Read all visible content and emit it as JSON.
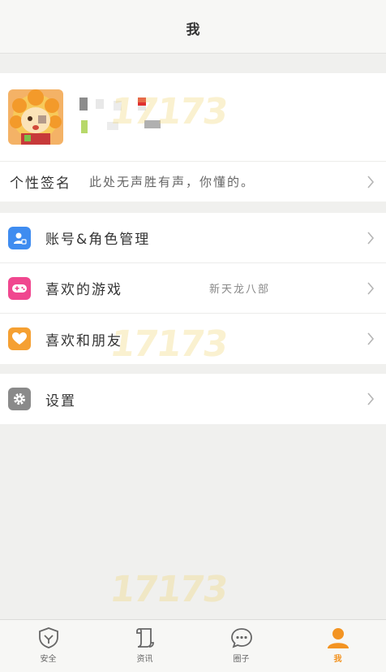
{
  "header": {
    "title": "我"
  },
  "profile": {
    "signature_label": "个性签名",
    "signature_value": "此处无声胜有声，你懂的。"
  },
  "menu": {
    "account": {
      "label": "账号&角色管理",
      "icon": "account-icon",
      "color": "#3f8cf0"
    },
    "games": {
      "label": "喜欢的游戏",
      "extra": "新天龙八部",
      "icon": "gamepad-icon",
      "color": "#f0478f"
    },
    "friends": {
      "label": "喜欢和朋友",
      "icon": "heart-icon",
      "color": "#f5a032"
    },
    "settings": {
      "label": "设置",
      "icon": "gear-icon",
      "color": "#8a8a8a"
    }
  },
  "watermark": "17173",
  "tabs": [
    {
      "label": "安全",
      "icon": "shield-icon",
      "active": false
    },
    {
      "label": "资讯",
      "icon": "scroll-icon",
      "active": false
    },
    {
      "label": "圈子",
      "icon": "chat-bubble-icon",
      "active": false
    },
    {
      "label": "我",
      "icon": "person-icon",
      "active": true
    }
  ],
  "colors": {
    "accent": "#f39422",
    "background": "#f0f0ee"
  }
}
